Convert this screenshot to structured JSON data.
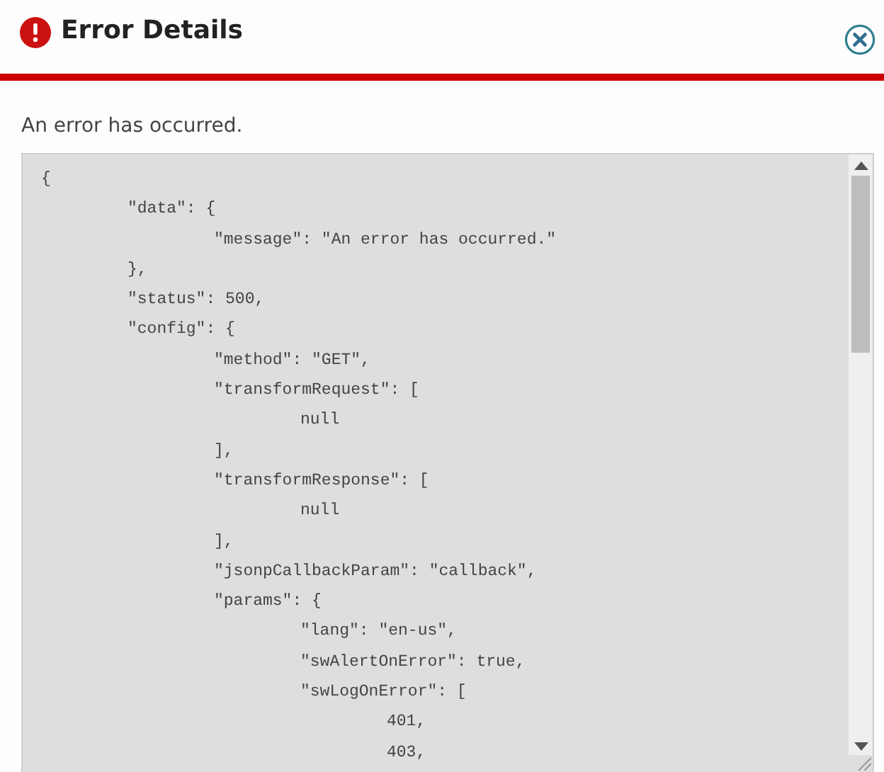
{
  "dialog": {
    "title": "Error Details",
    "message": "An error has occurred."
  },
  "details": {
    "lines": [
      "{",
      "\t\"data\": {",
      "\t\t\"message\": \"An error has occurred.\"",
      "\t},",
      "\t\"status\": 500,",
      "\t\"config\": {",
      "\t\t\"method\": \"GET\",",
      "\t\t\"transformRequest\": [",
      "\t\t\tnull",
      "\t\t],",
      "\t\t\"transformResponse\": [",
      "\t\t\tnull",
      "\t\t],",
      "\t\t\"jsonpCallbackParam\": \"callback\",",
      "\t\t\"params\": {",
      "\t\t\t\"lang\": \"en-us\",",
      "\t\t\t\"swAlertOnError\": true,",
      "\t\t\t\"swLogOnError\": [",
      "\t\t\t\t401,",
      "\t\t\t\t403,"
    ]
  }
}
